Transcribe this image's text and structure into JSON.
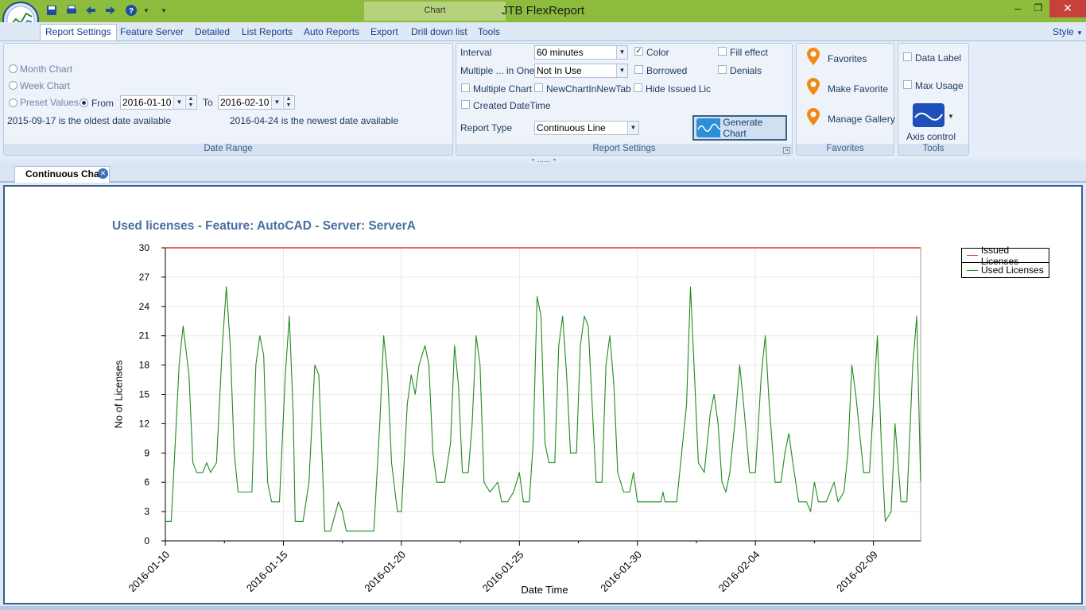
{
  "window": {
    "title": "JTB FlexReport",
    "contextual_tab_group": "Chart",
    "controls": [
      "minimize",
      "restore",
      "close"
    ]
  },
  "quick_access": {
    "icons": [
      "save-icon",
      "print-icon",
      "back-arrow-icon",
      "forward-arrow-icon",
      "help-icon",
      "customize-dropdown-icon"
    ]
  },
  "ribbon_tabs": [
    "Report Settings",
    "Feature Server",
    "Detailed",
    "List Reports",
    "Auto Reports",
    "Export",
    "Drill down list",
    "Tools"
  ],
  "style_menu": "Style",
  "date_range": {
    "caption": "Date Range",
    "month_chart": "Month Chart",
    "week_chart": "Week Chart",
    "preset_values": "Preset Values",
    "from_label": "From",
    "from_value": "2016-01-10",
    "to_label": "To",
    "to_value": "2016-02-10",
    "oldest_note": "2015-09-17 is the oldest date available",
    "newest_note": "2016-04-24 is the newest date available"
  },
  "report_settings": {
    "caption": "Report Settings",
    "interval_label": "Interval",
    "interval_value": "60 minutes",
    "multiple_label": "Multiple ... in One",
    "multiple_value": "Not In Use",
    "report_type_label": "Report Type",
    "report_type_value": "Continuous Line",
    "checks": {
      "color": "Color",
      "fill_effect": "Fill effect",
      "borrowed": "Borrowed",
      "denials": "Denials",
      "multiple_chart": "Multiple Chart",
      "new_chart_in_new_tab": "NewChartInNewTab",
      "hide_issued_lic": "Hide Issued Lic",
      "created_datetime": "Created DateTime"
    },
    "generate_button": "Generate Chart"
  },
  "favorites": {
    "caption": "Favorites",
    "items": [
      "Favorites",
      "Make Favorite",
      "Manage Gallery"
    ]
  },
  "tools": {
    "caption": "Tools",
    "data_label": "Data Label",
    "max_usage": "Max Usage",
    "axis_control": "Axis control"
  },
  "document_tab": "Continuous Chart",
  "colors": {
    "titlebar": "#8dbc3c",
    "issued_line": "#e03a2e",
    "used_line": "#1f8a1f",
    "close_button": "#c7403a"
  },
  "chart_data": {
    "type": "line",
    "title": "Used licenses - Feature: AutoCAD - Server: ServerA",
    "xlabel": "Date Time",
    "ylabel": "No of Licenses",
    "ylim": [
      0,
      30
    ],
    "yticks": [
      0,
      3,
      6,
      9,
      12,
      15,
      18,
      21,
      24,
      27,
      30
    ],
    "xlim": [
      "2016-01-10",
      "2016-02-11"
    ],
    "xticks": [
      "2016-01-10",
      "2016-01-15",
      "2016-01-20",
      "2016-01-25",
      "2016-01-30",
      "2016-02-04",
      "2016-02-09"
    ],
    "grid": true,
    "legend_position": "right",
    "series": [
      {
        "name": "Issued Licenses",
        "color": "#e03a2e",
        "points": [
          [
            "2016-01-10 00:00",
            30
          ],
          [
            "2016-02-11 00:00",
            30
          ]
        ]
      },
      {
        "name": "Used Licenses",
        "color": "#1f8a1f",
        "points": [
          [
            "2016-01-10 00:00",
            2
          ],
          [
            "2016-01-10 06:00",
            2
          ],
          [
            "2016-01-10 10:00",
            10
          ],
          [
            "2016-01-10 14:00",
            18
          ],
          [
            "2016-01-10 18:00",
            22
          ],
          [
            "2016-01-11 00:00",
            17
          ],
          [
            "2016-01-11 04:00",
            8
          ],
          [
            "2016-01-11 08:00",
            7
          ],
          [
            "2016-01-11 14:00",
            7
          ],
          [
            "2016-01-11 18:00",
            8
          ],
          [
            "2016-01-11 22:00",
            7
          ],
          [
            "2016-01-12 04:00",
            8
          ],
          [
            "2016-01-12 10:00",
            20
          ],
          [
            "2016-01-12 14:00",
            26
          ],
          [
            "2016-01-12 18:00",
            20
          ],
          [
            "2016-01-12 22:00",
            9
          ],
          [
            "2016-01-13 02:00",
            5
          ],
          [
            "2016-01-13 10:00",
            5
          ],
          [
            "2016-01-13 16:00",
            5
          ],
          [
            "2016-01-13 20:00",
            18
          ],
          [
            "2016-01-14 00:00",
            21
          ],
          [
            "2016-01-14 04:00",
            19
          ],
          [
            "2016-01-14 08:00",
            6
          ],
          [
            "2016-01-14 12:00",
            4
          ],
          [
            "2016-01-14 20:00",
            4
          ],
          [
            "2016-01-15 02:00",
            17
          ],
          [
            "2016-01-15 06:00",
            23
          ],
          [
            "2016-01-15 10:00",
            13
          ],
          [
            "2016-01-15 12:00",
            2
          ],
          [
            "2016-01-15 20:00",
            2
          ],
          [
            "2016-01-16 02:00",
            6
          ],
          [
            "2016-01-16 08:00",
            18
          ],
          [
            "2016-01-16 12:00",
            17
          ],
          [
            "2016-01-16 16:00",
            7
          ],
          [
            "2016-01-16 18:00",
            1
          ],
          [
            "2016-01-17 00:00",
            1
          ],
          [
            "2016-01-17 08:00",
            4
          ],
          [
            "2016-01-17 12:00",
            3
          ],
          [
            "2016-01-17 14:00",
            2
          ],
          [
            "2016-01-17 16:00",
            1
          ],
          [
            "2016-01-18 20:00",
            1
          ],
          [
            "2016-01-19 02:00",
            12
          ],
          [
            "2016-01-19 06:00",
            21
          ],
          [
            "2016-01-19 10:00",
            17
          ],
          [
            "2016-01-19 14:00",
            8
          ],
          [
            "2016-01-19 20:00",
            3
          ],
          [
            "2016-01-20 00:00",
            3
          ],
          [
            "2016-01-20 06:00",
            14
          ],
          [
            "2016-01-20 10:00",
            17
          ],
          [
            "2016-01-20 14:00",
            15
          ],
          [
            "2016-01-20 18:00",
            18
          ],
          [
            "2016-01-21 00:00",
            20
          ],
          [
            "2016-01-21 04:00",
            18
          ],
          [
            "2016-01-21 08:00",
            9
          ],
          [
            "2016-01-21 12:00",
            6
          ],
          [
            "2016-01-21 20:00",
            6
          ],
          [
            "2016-01-22 02:00",
            10
          ],
          [
            "2016-01-22 06:00",
            20
          ],
          [
            "2016-01-22 10:00",
            16
          ],
          [
            "2016-01-22 14:00",
            7
          ],
          [
            "2016-01-22 20:00",
            7
          ],
          [
            "2016-01-23 00:00",
            12
          ],
          [
            "2016-01-23 04:00",
            21
          ],
          [
            "2016-01-23 08:00",
            18
          ],
          [
            "2016-01-23 12:00",
            6
          ],
          [
            "2016-01-23 18:00",
            5
          ],
          [
            "2016-01-24 02:00",
            6
          ],
          [
            "2016-01-24 06:00",
            4
          ],
          [
            "2016-01-24 12:00",
            4
          ],
          [
            "2016-01-24 18:00",
            5
          ],
          [
            "2016-01-25 00:00",
            7
          ],
          [
            "2016-01-25 04:00",
            4
          ],
          [
            "2016-01-25 10:00",
            4
          ],
          [
            "2016-01-25 14:00",
            10
          ],
          [
            "2016-01-25 18:00",
            25
          ],
          [
            "2016-01-25 22:00",
            23
          ],
          [
            "2016-01-26 02:00",
            10
          ],
          [
            "2016-01-26 06:00",
            8
          ],
          [
            "2016-01-26 12:00",
            8
          ],
          [
            "2016-01-26 16:00",
            20
          ],
          [
            "2016-01-26 20:00",
            23
          ],
          [
            "2016-01-27 00:00",
            17
          ],
          [
            "2016-01-27 04:00",
            9
          ],
          [
            "2016-01-27 10:00",
            9
          ],
          [
            "2016-01-27 14:00",
            20
          ],
          [
            "2016-01-27 18:00",
            23
          ],
          [
            "2016-01-27 22:00",
            22
          ],
          [
            "2016-01-28 02:00",
            14
          ],
          [
            "2016-01-28 06:00",
            6
          ],
          [
            "2016-01-28 12:00",
            6
          ],
          [
            "2016-01-28 16:00",
            18
          ],
          [
            "2016-01-28 20:00",
            21
          ],
          [
            "2016-01-29 00:00",
            16
          ],
          [
            "2016-01-29 04:00",
            7
          ],
          [
            "2016-01-29 10:00",
            5
          ],
          [
            "2016-01-29 16:00",
            5
          ],
          [
            "2016-01-29 20:00",
            7
          ],
          [
            "2016-01-30 00:00",
            4
          ],
          [
            "2016-01-30 12:00",
            4
          ],
          [
            "2016-01-31 00:00",
            4
          ],
          [
            "2016-01-31 02:00",
            5
          ],
          [
            "2016-01-31 04:00",
            4
          ],
          [
            "2016-01-31 16:00",
            4
          ],
          [
            "2016-02-01 02:00",
            14
          ],
          [
            "2016-02-01 06:00",
            26
          ],
          [
            "2016-02-01 10:00",
            17
          ],
          [
            "2016-02-01 14:00",
            8
          ],
          [
            "2016-02-01 20:00",
            7
          ],
          [
            "2016-02-02 02:00",
            13
          ],
          [
            "2016-02-02 06:00",
            15
          ],
          [
            "2016-02-02 10:00",
            12
          ],
          [
            "2016-02-02 14:00",
            6
          ],
          [
            "2016-02-02 18:00",
            5
          ],
          [
            "2016-02-02 22:00",
            7
          ],
          [
            "2016-02-03 04:00",
            13
          ],
          [
            "2016-02-03 08:00",
            18
          ],
          [
            "2016-02-03 12:00",
            14
          ],
          [
            "2016-02-03 18:00",
            7
          ],
          [
            "2016-02-04 00:00",
            7
          ],
          [
            "2016-02-04 06:00",
            17
          ],
          [
            "2016-02-04 10:00",
            21
          ],
          [
            "2016-02-04 14:00",
            14
          ],
          [
            "2016-02-04 20:00",
            6
          ],
          [
            "2016-02-05 02:00",
            6
          ],
          [
            "2016-02-05 06:00",
            9
          ],
          [
            "2016-02-05 10:00",
            11
          ],
          [
            "2016-02-05 14:00",
            8
          ],
          [
            "2016-02-05 20:00",
            4
          ],
          [
            "2016-02-06 04:00",
            4
          ],
          [
            "2016-02-06 08:00",
            3
          ],
          [
            "2016-02-06 12:00",
            6
          ],
          [
            "2016-02-06 16:00",
            4
          ],
          [
            "2016-02-07 00:00",
            4
          ],
          [
            "2016-02-07 08:00",
            6
          ],
          [
            "2016-02-07 12:00",
            4
          ],
          [
            "2016-02-07 18:00",
            5
          ],
          [
            "2016-02-07 22:00",
            9
          ],
          [
            "2016-02-08 02:00",
            18
          ],
          [
            "2016-02-08 06:00",
            15
          ],
          [
            "2016-02-08 10:00",
            11
          ],
          [
            "2016-02-08 14:00",
            7
          ],
          [
            "2016-02-08 20:00",
            7
          ],
          [
            "2016-02-09 00:00",
            14
          ],
          [
            "2016-02-09 04:00",
            21
          ],
          [
            "2016-02-09 08:00",
            10
          ],
          [
            "2016-02-09 12:00",
            2
          ],
          [
            "2016-02-09 18:00",
            3
          ],
          [
            "2016-02-09 22:00",
            12
          ],
          [
            "2016-02-10 04:00",
            4
          ],
          [
            "2016-02-10 10:00",
            4
          ],
          [
            "2016-02-10 16:00",
            18
          ],
          [
            "2016-02-10 20:00",
            23
          ],
          [
            "2016-02-11 00:00",
            6
          ]
        ]
      }
    ]
  }
}
